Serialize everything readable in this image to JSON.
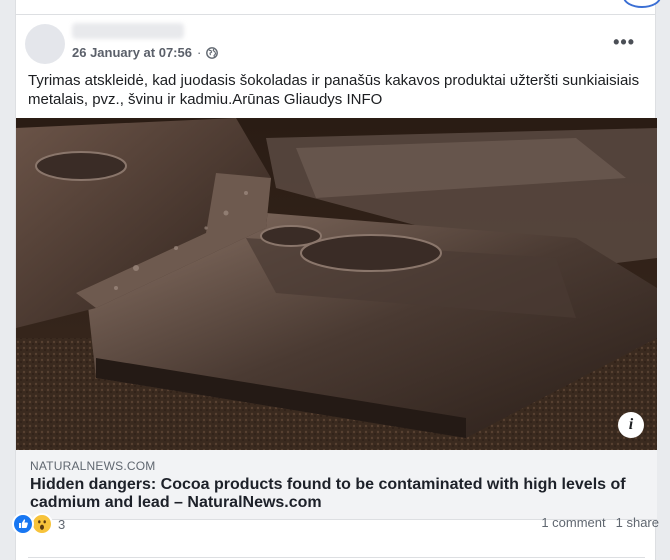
{
  "post": {
    "author_name": "",
    "date": "26 January at 07:56",
    "separator": "·",
    "privacy_icon": "globe-icon",
    "more_icon": "more-options-icon",
    "text": "Tyrimas atskleidė, kad juodasis šokoladas ir panašūs kakavos produktai užteršti sunkiaisiais metalais, pvz., švinu ir kadmiu.Arūnas Gliaudys INFO"
  },
  "link_preview": {
    "image_icon": "info-icon",
    "domain": "NATURALNEWS.COM",
    "headline": "Hidden dangers: Cocoa products found to be contaminated with high levels of cadmium and lead – NaturalNews.com"
  },
  "footer": {
    "reaction_icons": [
      "like-icon",
      "wow-icon"
    ],
    "reaction_count": "3",
    "comments": "1 comment",
    "shares": "1 share"
  },
  "colors": {
    "like": "#1877f2",
    "wow": "#f7c33b",
    "link_box_bg": "#f2f3f5"
  }
}
